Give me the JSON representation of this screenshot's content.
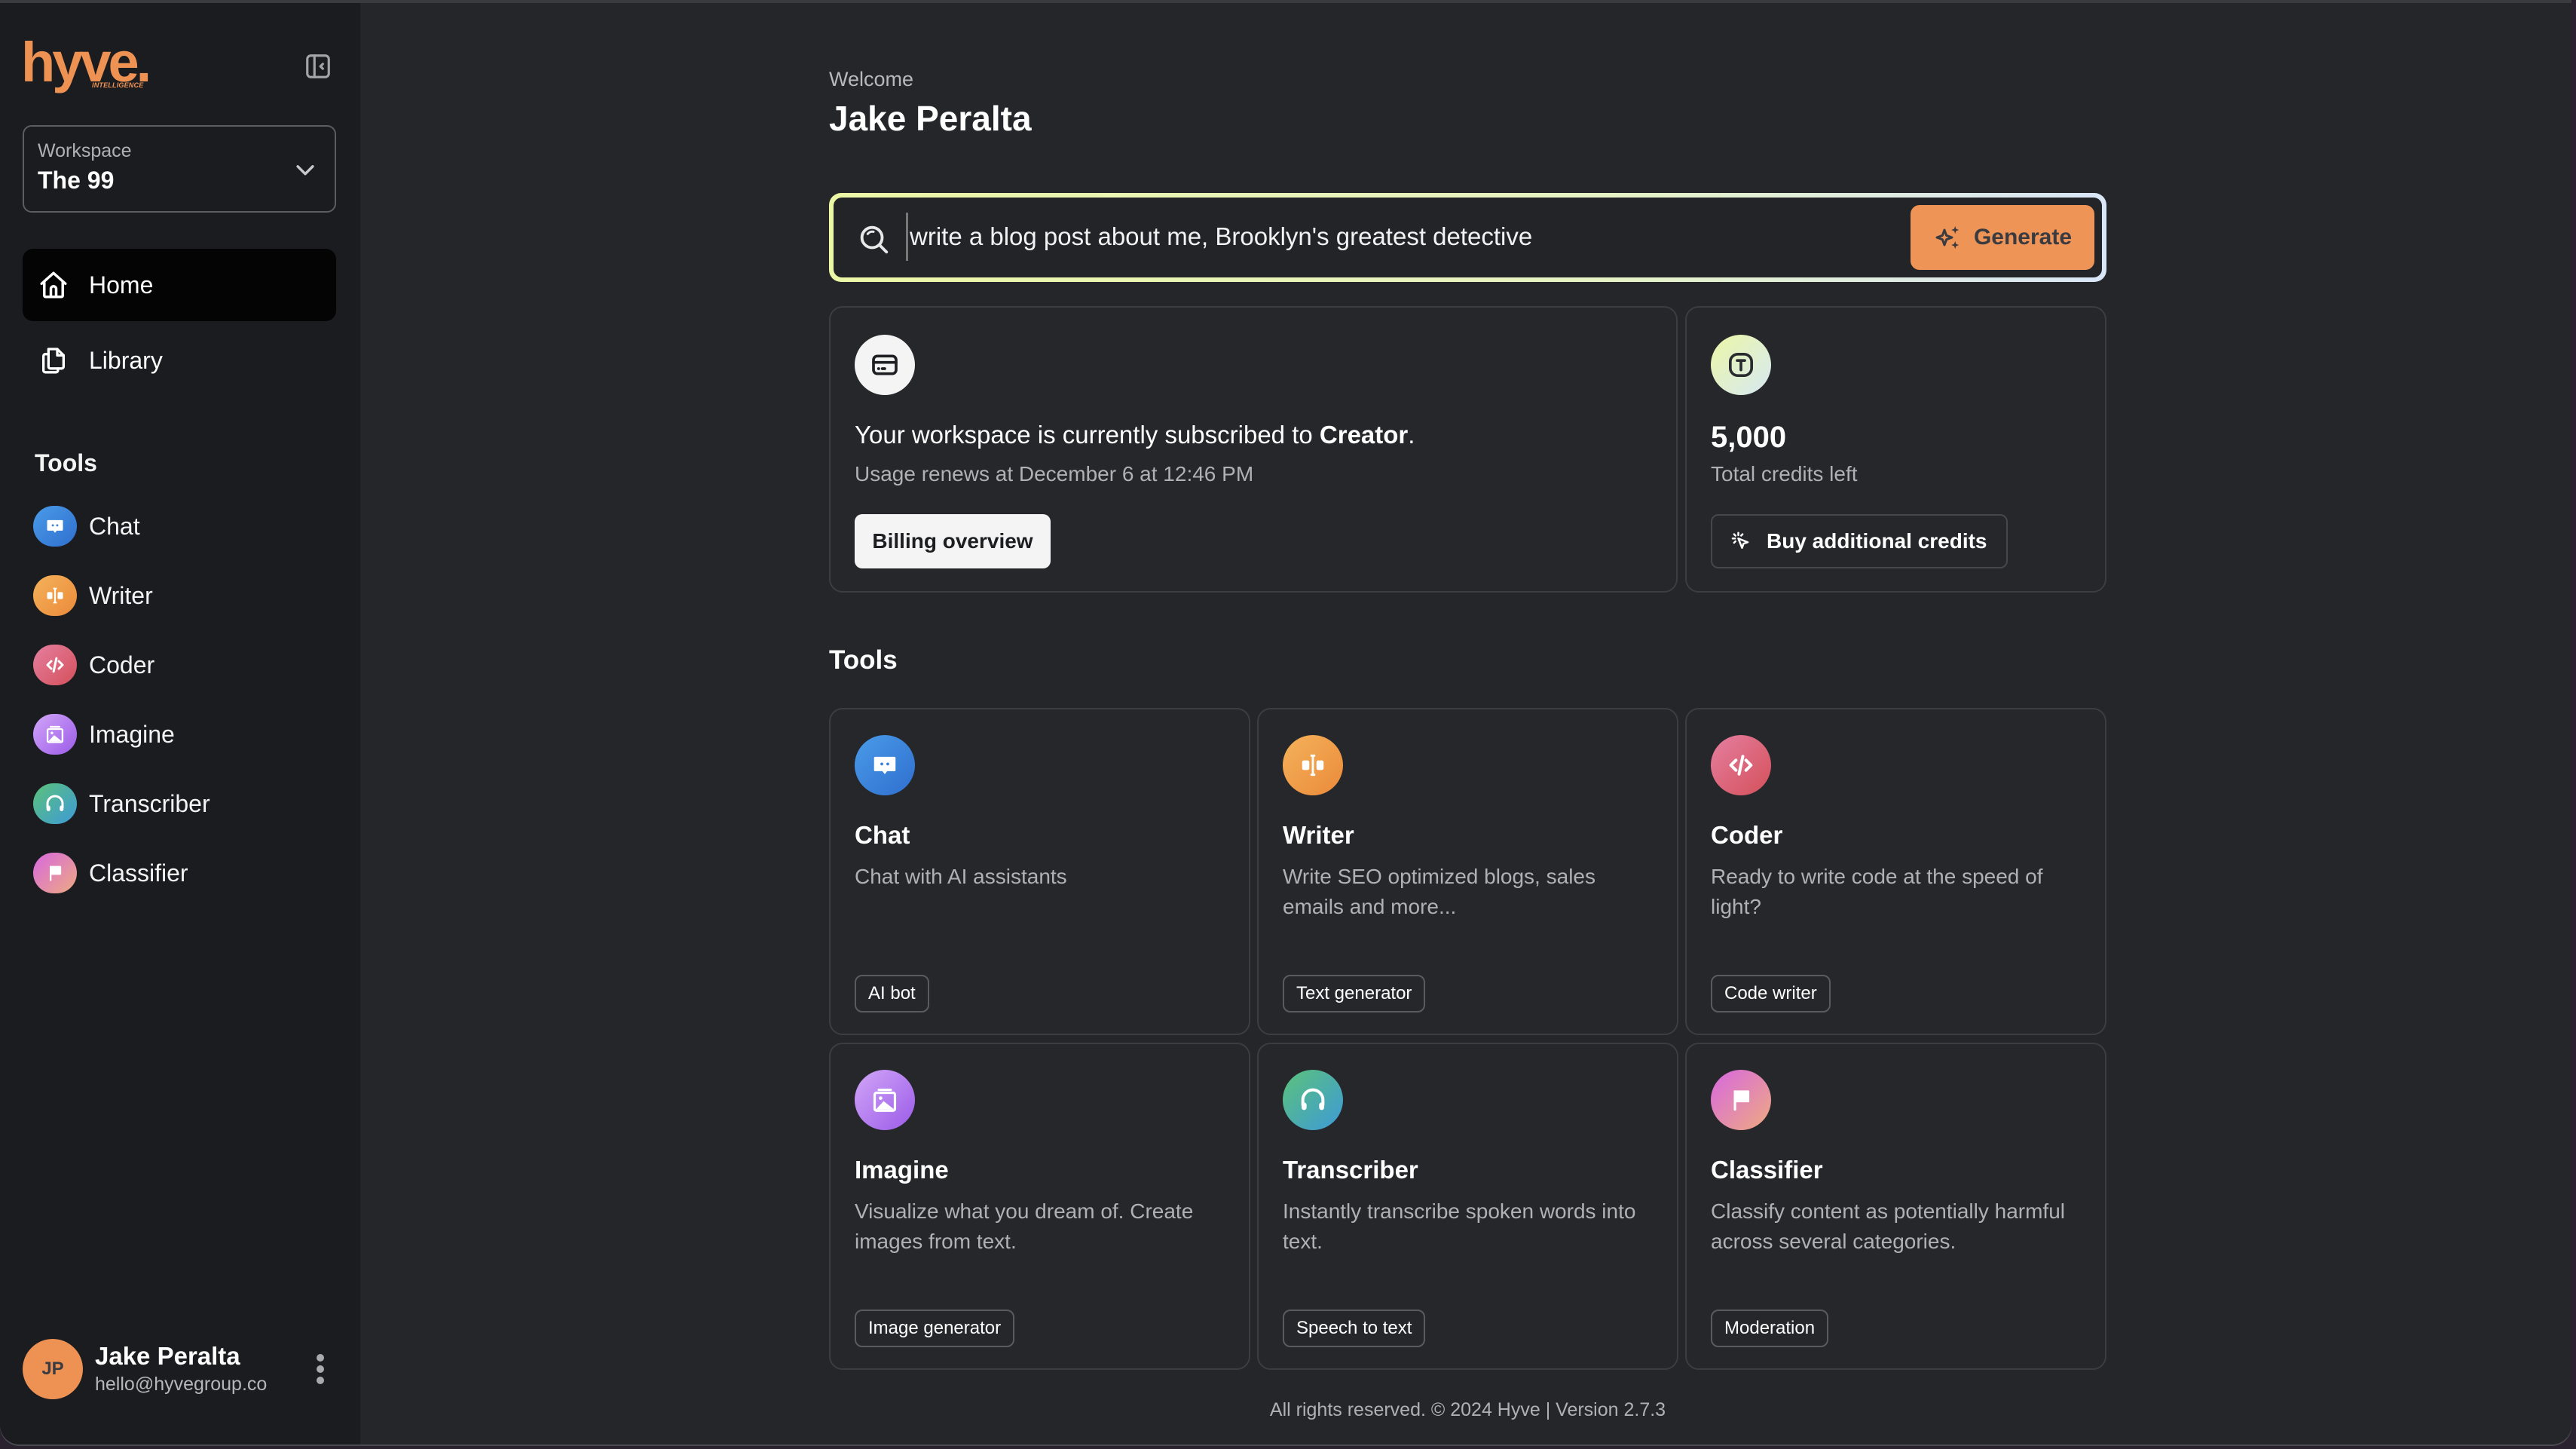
{
  "sidebar": {
    "logo": {
      "word": "hyve.",
      "tagline": "INTELLIGENCE"
    },
    "workspace": {
      "label": "Workspace",
      "value": "The 99"
    },
    "nav": [
      {
        "label": "Home",
        "icon": "home-icon",
        "active": true
      },
      {
        "label": "Library",
        "icon": "library-icon",
        "active": false
      }
    ],
    "tools_label": "Tools",
    "tools": [
      {
        "label": "Chat",
        "icon": "chat-icon"
      },
      {
        "label": "Writer",
        "icon": "writer-icon"
      },
      {
        "label": "Coder",
        "icon": "code-icon"
      },
      {
        "label": "Imagine",
        "icon": "image-icon"
      },
      {
        "label": "Transcriber",
        "icon": "headphones-icon"
      },
      {
        "label": "Classifier",
        "icon": "flag-icon"
      }
    ],
    "user": {
      "initials": "JP",
      "name": "Jake Peralta",
      "email": "hello@hyvegroup.co"
    }
  },
  "main": {
    "welcome": "Welcome",
    "name": "Jake Peralta",
    "search": {
      "value": "write a blog post about me, Brooklyn's greatest detective",
      "button": "Generate"
    },
    "billing": {
      "text_prefix": "Your workspace is currently subscribed to ",
      "plan": "Creator",
      "text_suffix": ".",
      "renews": "Usage renews at December 6 at 12:46 PM",
      "button": "Billing overview"
    },
    "credits": {
      "amount": "5,000",
      "caption": "Total credits left",
      "button": "Buy additional credits"
    },
    "tools_heading": "Tools",
    "tool_cards": [
      {
        "title": "Chat",
        "desc": "Chat with AI assistants",
        "tag": "AI bot"
      },
      {
        "title": "Writer",
        "desc": "Write SEO optimized blogs, sales emails and more...",
        "tag": "Text generator"
      },
      {
        "title": "Coder",
        "desc": "Ready to write code at the speed of light?",
        "tag": "Code writer"
      },
      {
        "title": "Imagine",
        "desc": "Visualize what you dream of. Create images from text.",
        "tag": "Image generator"
      },
      {
        "title": "Transcriber",
        "desc": "Instantly transcribe spoken words into text.",
        "tag": "Speech to text"
      },
      {
        "title": "Classifier",
        "desc": "Classify content as potentially harmful across several categories.",
        "tag": "Moderation"
      }
    ],
    "footer": "All rights reserved. © 2024 Hyve | Version 2.7.3"
  },
  "colors": {
    "accent": "#ee9254",
    "sidebar_bg": "#1b1c1f",
    "main_bg": "#25262a",
    "card_bg": "#26272b"
  }
}
